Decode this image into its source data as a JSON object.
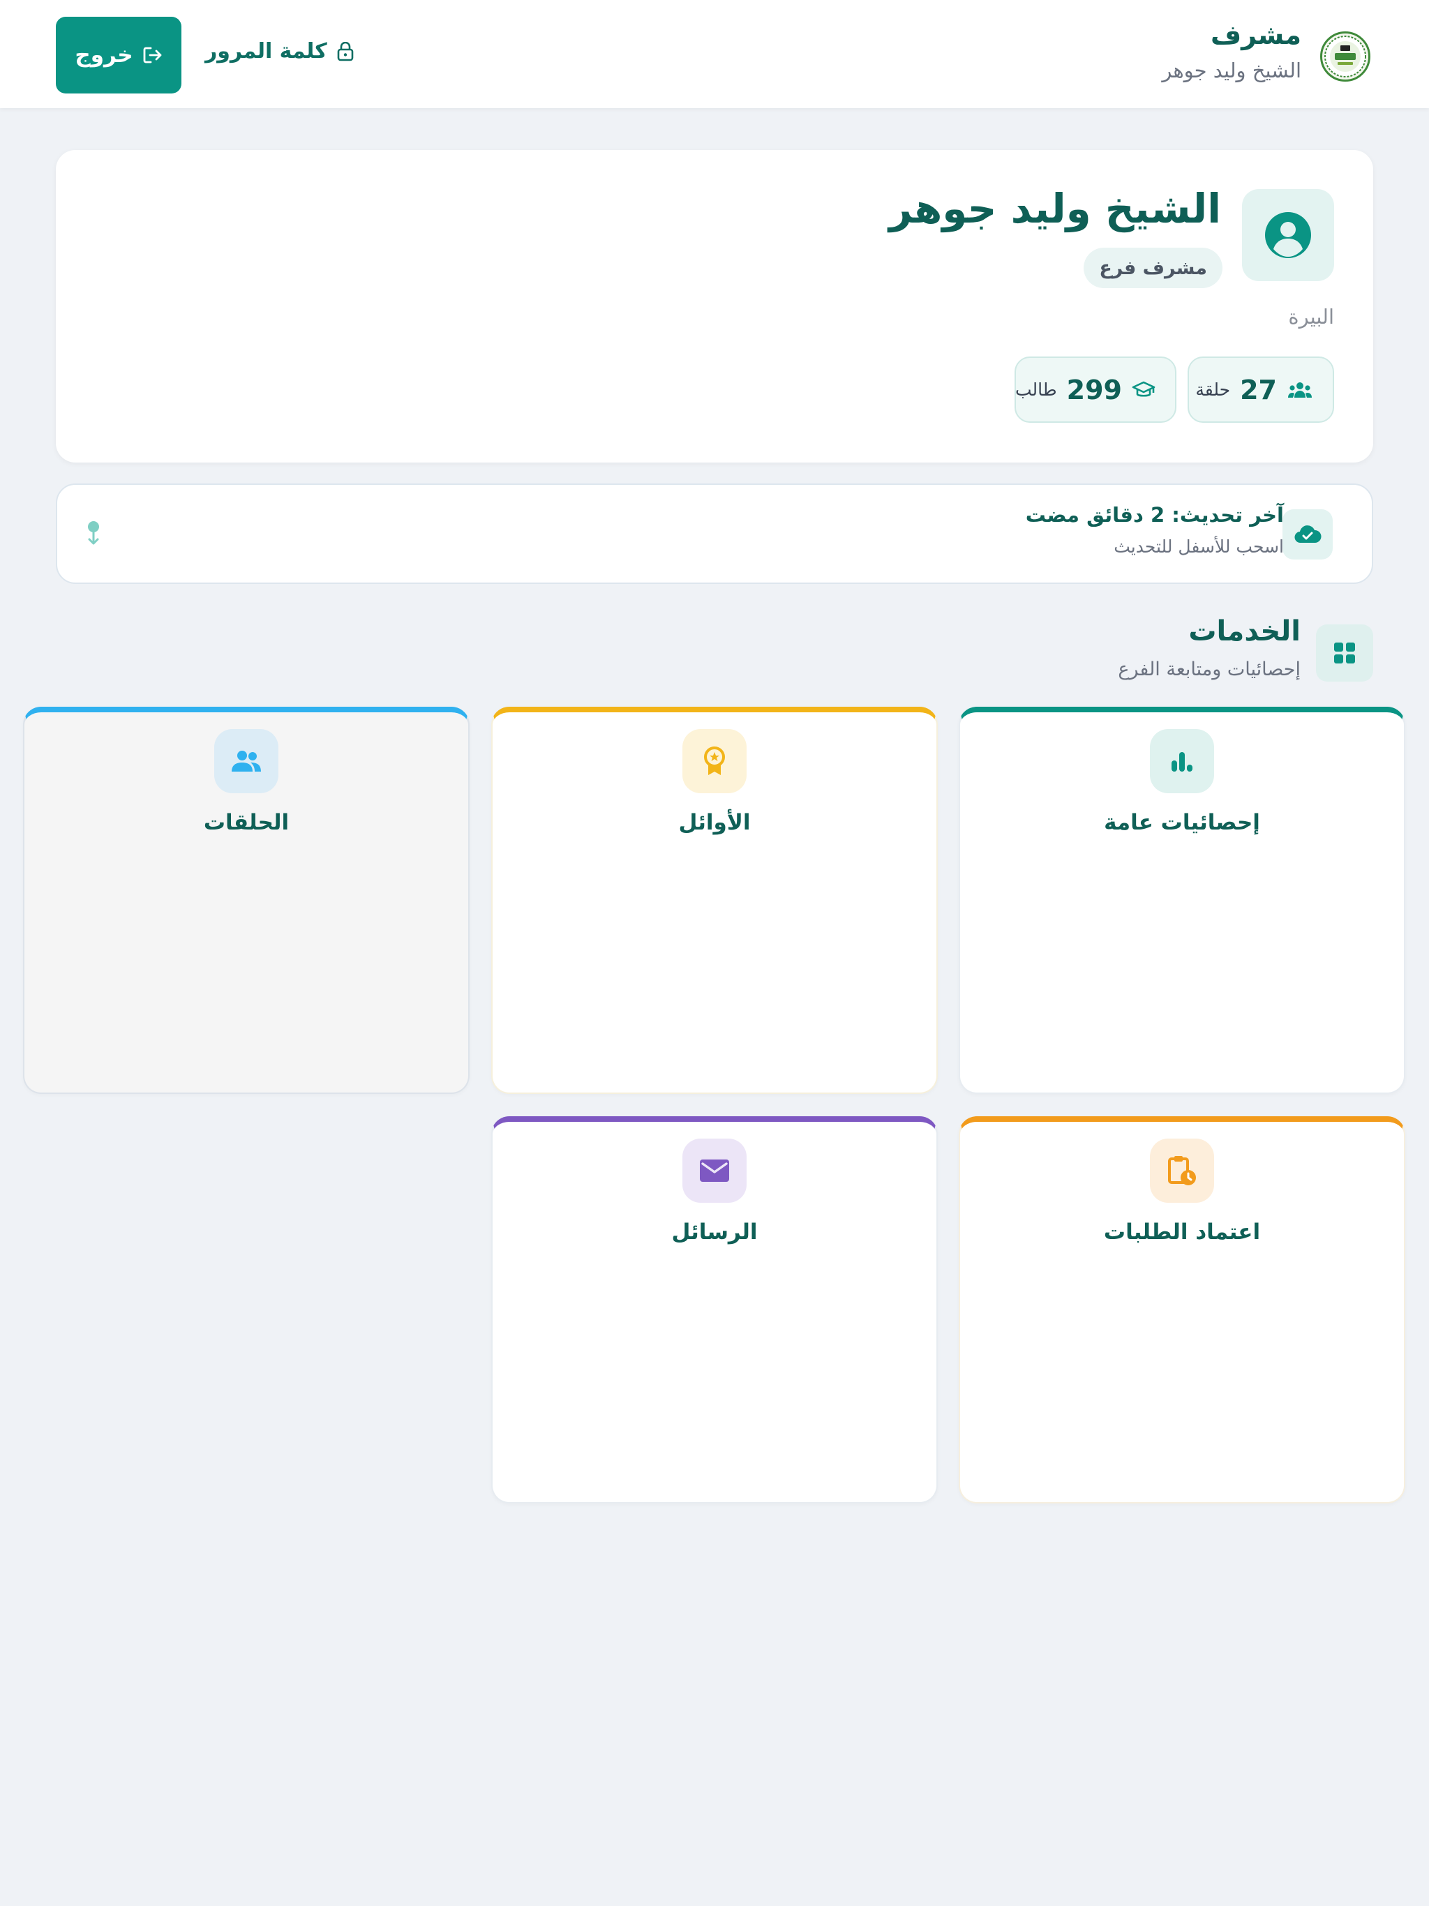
{
  "header": {
    "role_title": "مشرف",
    "role_name": "الشيخ وليد جوهر",
    "password_label": "كلمة المرور",
    "logout_label": "خروج",
    "logo_text": "معهد"
  },
  "profile": {
    "name": "الشيخ وليد جوهر",
    "role_badge": "مشرف فرع",
    "branch": "البيرة",
    "stats": {
      "circles": {
        "value": "27",
        "label": "حلقة"
      },
      "students": {
        "value": "299",
        "label": "طالب"
      }
    }
  },
  "refresh": {
    "title": "آخر تحديث: 2 دقائق مضت",
    "hint": "اسحب للأسفل للتحديث"
  },
  "services": {
    "title": "الخدمات",
    "subtitle": "إحصائيات ومتابعة الفرع",
    "tiles": [
      {
        "label": "إحصائيات عامة",
        "icon": "bar-chart-icon",
        "accent": "#0a9484"
      },
      {
        "label": "الأوائل",
        "icon": "award-icon",
        "accent": "#f2b418"
      },
      {
        "label": "الحلقات",
        "icon": "group-icon",
        "accent": "#2fb1ef"
      },
      {
        "label": "اعتماد الطلبات",
        "icon": "clipboard-clock-icon",
        "accent": "#f29b1c"
      },
      {
        "label": "الرسائل",
        "icon": "mail-icon",
        "accent": "#7e58c2"
      }
    ]
  },
  "colors": {
    "primary": "#0a9484",
    "background": "#eff2f6"
  }
}
